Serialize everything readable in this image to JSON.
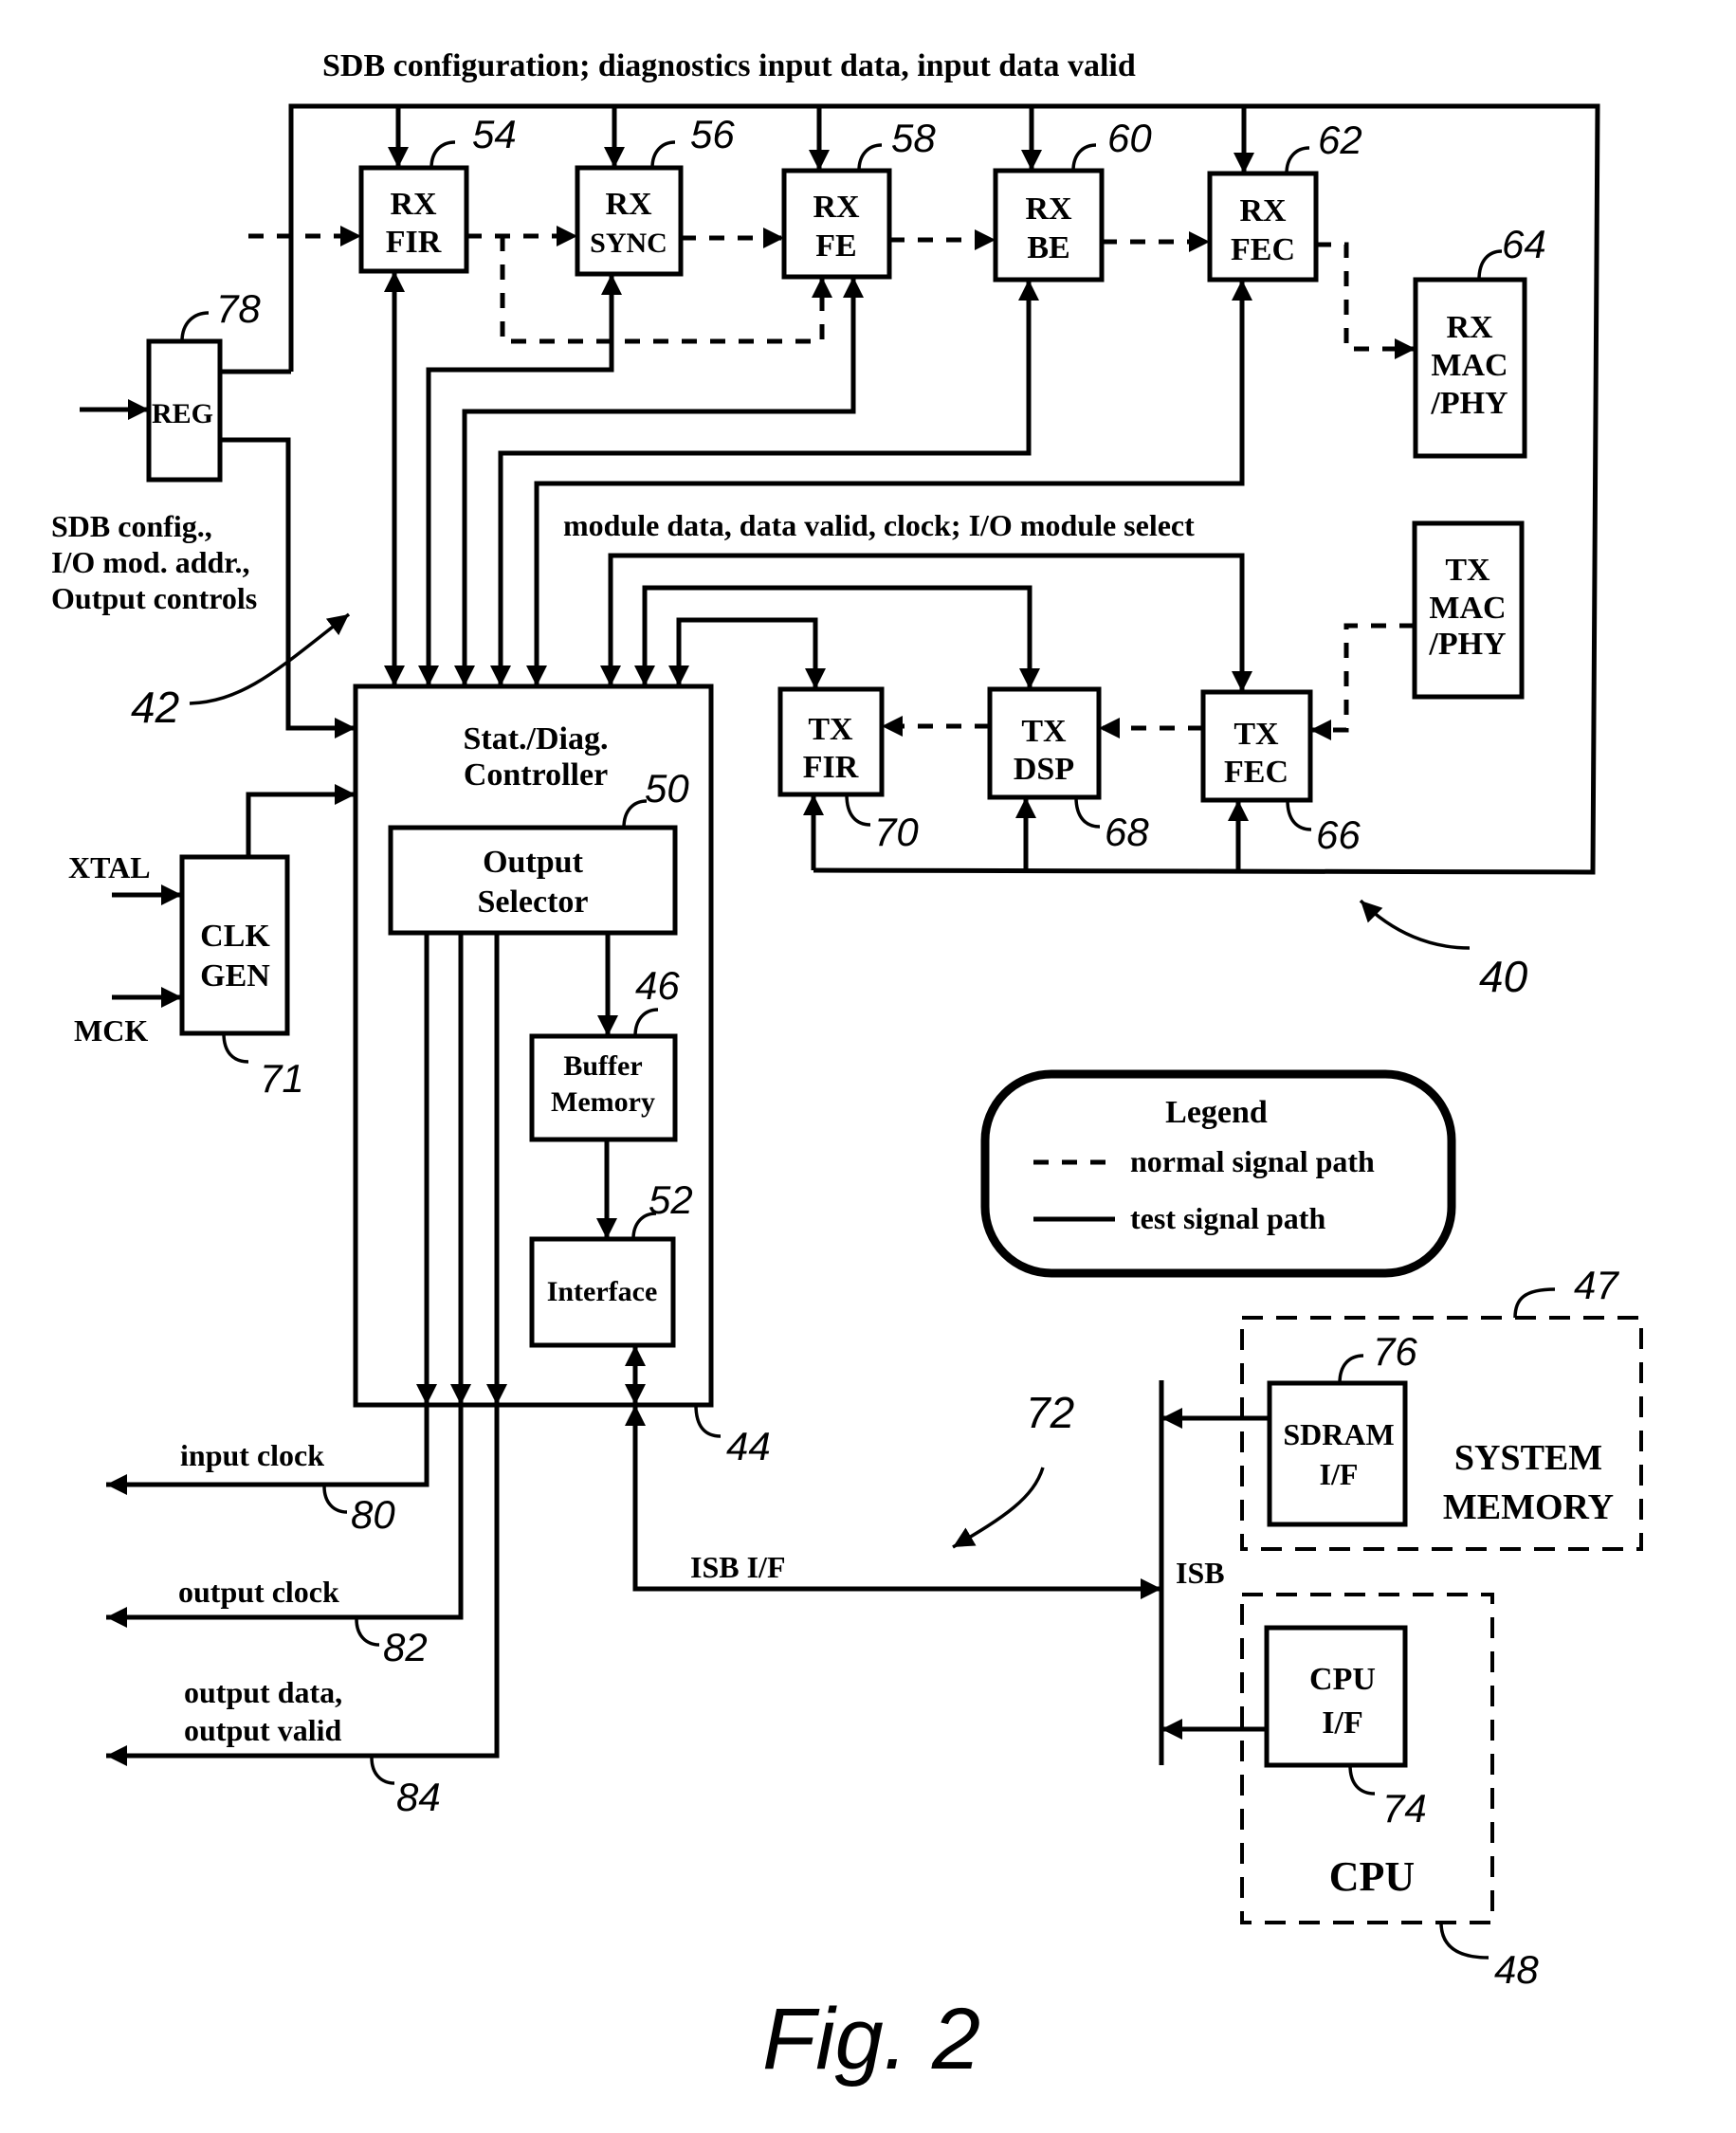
{
  "figure": {
    "caption": "Fig. 2",
    "top_bus_label": "SDB configuration; diagnostics input data, input data valid",
    "module_bus_label": "module data, data valid, clock; I/O module select",
    "reg_output_label": [
      "SDB config.,",
      "I/O mod. addr.,",
      "Output controls"
    ]
  },
  "blocks": {
    "rx_fir": {
      "lines": [
        "RX",
        "FIR"
      ],
      "ref": "54"
    },
    "rx_sync": {
      "lines": [
        "RX",
        "SYNC"
      ],
      "ref": "56"
    },
    "rx_fe": {
      "lines": [
        "RX",
        "FE"
      ],
      "ref": "58"
    },
    "rx_be": {
      "lines": [
        "RX",
        "BE"
      ],
      "ref": "60"
    },
    "rx_fec": {
      "lines": [
        "RX",
        "FEC"
      ],
      "ref": "62"
    },
    "rx_mac": {
      "lines": [
        "RX",
        "MAC",
        "/PHY"
      ],
      "ref": "64"
    },
    "reg": {
      "lines": [
        "REG"
      ],
      "ref": "78"
    },
    "controller": {
      "lines": [
        "Stat./Diag.",
        "Controller"
      ],
      "ref": "44"
    },
    "output_selector": {
      "lines": [
        "Output",
        "Selector"
      ],
      "ref": "50"
    },
    "buffer_memory": {
      "lines": [
        "Buffer",
        "Memory"
      ],
      "ref": "46"
    },
    "interface": {
      "lines": [
        "Interface"
      ],
      "ref": "52"
    },
    "tx_fir": {
      "lines": [
        "TX",
        "FIR"
      ],
      "ref": "70"
    },
    "tx_dsp": {
      "lines": [
        "TX",
        "DSP"
      ],
      "ref": "68"
    },
    "tx_fec": {
      "lines": [
        "TX",
        "FEC"
      ],
      "ref": "66"
    },
    "tx_mac": {
      "lines": [
        "TX",
        "MAC",
        "/PHY"
      ]
    },
    "clk_gen": {
      "lines": [
        "CLK",
        "GEN"
      ],
      "ref": "71"
    },
    "sdram_if": {
      "lines": [
        "SDRAM",
        "I/F"
      ],
      "ref": "76"
    },
    "cpu_if": {
      "lines": [
        "CPU",
        "I/F"
      ],
      "ref": "74"
    },
    "system_memory": {
      "lines": [
        "SYSTEM",
        "MEMORY"
      ],
      "ref": "47"
    },
    "cpu": {
      "lines": [
        "CPU"
      ],
      "ref": "48"
    }
  },
  "signals": {
    "xtal": "XTAL",
    "mck": "MCK",
    "input_clock": {
      "label": "input clock",
      "ref": "80"
    },
    "output_clock": {
      "label": "output clock",
      "ref": "82"
    },
    "output_data": {
      "label": [
        "output data,",
        "output valid"
      ],
      "ref": "84"
    },
    "isb_if": "ISB I/F",
    "isb": "ISB"
  },
  "refs": {
    "system": "40",
    "bus_group": "42",
    "isb_group": "72"
  },
  "legend": {
    "title": "Legend",
    "items": [
      {
        "style": "dashed",
        "label": "normal signal path"
      },
      {
        "style": "solid",
        "label": "test signal path"
      }
    ]
  }
}
